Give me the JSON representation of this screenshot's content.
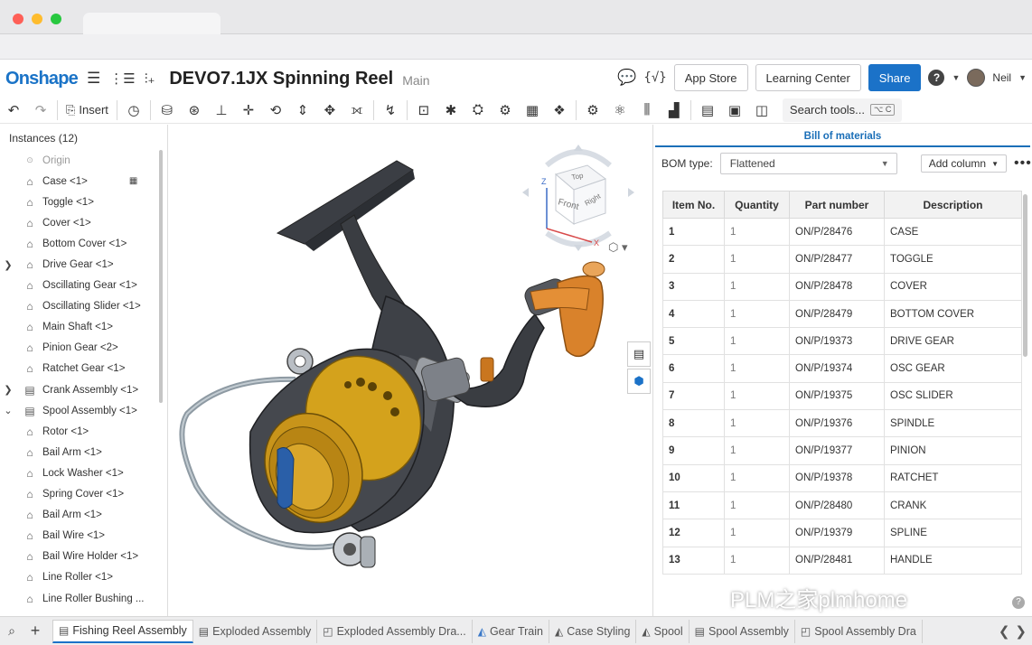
{
  "app": {
    "logo": "Onshape",
    "doc_title": "DEVO7.1JX Spinning Reel",
    "workspace": "Main"
  },
  "header": {
    "app_store": "App Store",
    "learning_center": "Learning Center",
    "share": "Share",
    "user": "Neil"
  },
  "toolbar": {
    "insert": "Insert",
    "search_tools": "Search tools...",
    "search_kbd": "⌥ C"
  },
  "instances": {
    "header": "Instances (12)",
    "items": [
      {
        "label": "Origin"
      },
      {
        "label": "Case <1>"
      },
      {
        "label": "Toggle <1>"
      },
      {
        "label": "Cover <1>"
      },
      {
        "label": "Bottom Cover <1>"
      },
      {
        "label": "Drive Gear <1>"
      },
      {
        "label": "Oscillating Gear <1>"
      },
      {
        "label": "Oscillating Slider <1>"
      },
      {
        "label": "Main Shaft <1>"
      },
      {
        "label": "Pinion Gear <2>"
      },
      {
        "label": "Ratchet Gear <1>"
      },
      {
        "label": "Crank Assembly <1>"
      },
      {
        "label": "Spool Assembly <1>"
      },
      {
        "label": "Rotor <1>"
      },
      {
        "label": "Bail Arm <1>"
      },
      {
        "label": "Lock Washer <1>"
      },
      {
        "label": "Spring Cover <1>"
      },
      {
        "label": "Bail Arm <1>"
      },
      {
        "label": "Bail Wire <1>"
      },
      {
        "label": "Bail Wire Holder <1>"
      },
      {
        "label": "Line Roller <1>"
      },
      {
        "label": "Line Roller Bushing ..."
      }
    ]
  },
  "viewcube": {
    "top": "Top",
    "front": "Front",
    "right": "Right",
    "axis_x": "X",
    "axis_z": "Z"
  },
  "bom": {
    "title": "Bill of materials",
    "type_label": "BOM type:",
    "type_value": "Flattened",
    "add_column": "Add column",
    "columns": [
      "Item No.",
      "Quantity",
      "Part number",
      "Description"
    ],
    "rows": [
      [
        "1",
        "1",
        "ON/P/28476",
        "CASE"
      ],
      [
        "2",
        "1",
        "ON/P/28477",
        "TOGGLE"
      ],
      [
        "3",
        "1",
        "ON/P/28478",
        "COVER"
      ],
      [
        "4",
        "1",
        "ON/P/28479",
        "BOTTOM COVER"
      ],
      [
        "5",
        "1",
        "ON/P/19373",
        "DRIVE GEAR"
      ],
      [
        "6",
        "1",
        "ON/P/19374",
        "OSC GEAR"
      ],
      [
        "7",
        "1",
        "ON/P/19375",
        "OSC SLIDER"
      ],
      [
        "8",
        "1",
        "ON/P/19376",
        "SPINDLE"
      ],
      [
        "9",
        "1",
        "ON/P/19377",
        "PINION"
      ],
      [
        "10",
        "1",
        "ON/P/19378",
        "RATCHET"
      ],
      [
        "11",
        "1",
        "ON/P/28480",
        "CRANK"
      ],
      [
        "12",
        "1",
        "ON/P/19379",
        "SPLINE"
      ],
      [
        "13",
        "1",
        "ON/P/28481",
        "HANDLE"
      ]
    ]
  },
  "watermark": "PLM之家plmhome",
  "tabs": [
    {
      "label": "Fishing Reel Assembly",
      "icon": "assembly-icon"
    },
    {
      "label": "Exploded Assembly",
      "icon": "assembly-icon"
    },
    {
      "label": "Exploded Assembly Dra...",
      "icon": "drawing-icon"
    },
    {
      "label": "Gear Train",
      "icon": "partstudio-icon"
    },
    {
      "label": "Case Styling",
      "icon": "partstudio-icon"
    },
    {
      "label": "Spool",
      "icon": "partstudio-icon"
    },
    {
      "label": "Spool Assembly",
      "icon": "assembly-icon"
    },
    {
      "label": "Spool Assembly Dra",
      "icon": "drawing-icon"
    }
  ],
  "colors": {
    "accent": "#1b72c8",
    "spool_gold": "#d4a21c",
    "handle_orange": "#d9822b",
    "body_dark": "#3a3d42"
  }
}
